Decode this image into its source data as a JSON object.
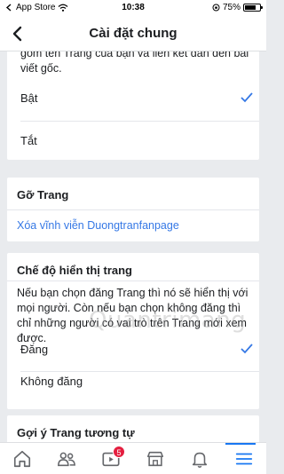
{
  "status_bar": {
    "carrier": "App Store",
    "time": "10:38",
    "battery": "75%",
    "battery_level": 0.75
  },
  "header": {
    "title": "Cài đặt chung"
  },
  "visibility_option": {
    "description": "gồm tên Trang của bạn và liên kết dẫn đến bài viết gốc.",
    "options": [
      {
        "label": "Bật",
        "checked": true
      },
      {
        "label": "Tắt",
        "checked": false
      }
    ]
  },
  "remove_page": {
    "title": "Gỡ Trang",
    "link": "Xóa vĩnh viễn Duongtranfanpage"
  },
  "page_visibility": {
    "title": "Chế độ hiển thị trang",
    "description": "Nếu bạn chọn đăng Trang thì nó sẽ hiển thị với mọi người. Còn nếu bạn chọn không đăng thì chỉ những người có vai trò trên Trang mới xem được.",
    "options": [
      {
        "label": "Đăng",
        "checked": true
      },
      {
        "label": "Không đăng",
        "checked": false
      }
    ]
  },
  "similar_pages": {
    "title": "Gợi ý Trang tương tự"
  },
  "watermark": "Quantrimang",
  "tab_bar": {
    "tabs": [
      "home-icon",
      "groups-icon",
      "video-icon",
      "marketplace-icon",
      "notifications-icon",
      "menu-icon"
    ],
    "video_badge": "5",
    "active_tab": "menu-icon"
  },
  "colors": {
    "accent": "#1877f2",
    "link": "#3578e5",
    "badge": "#e41e3f"
  }
}
